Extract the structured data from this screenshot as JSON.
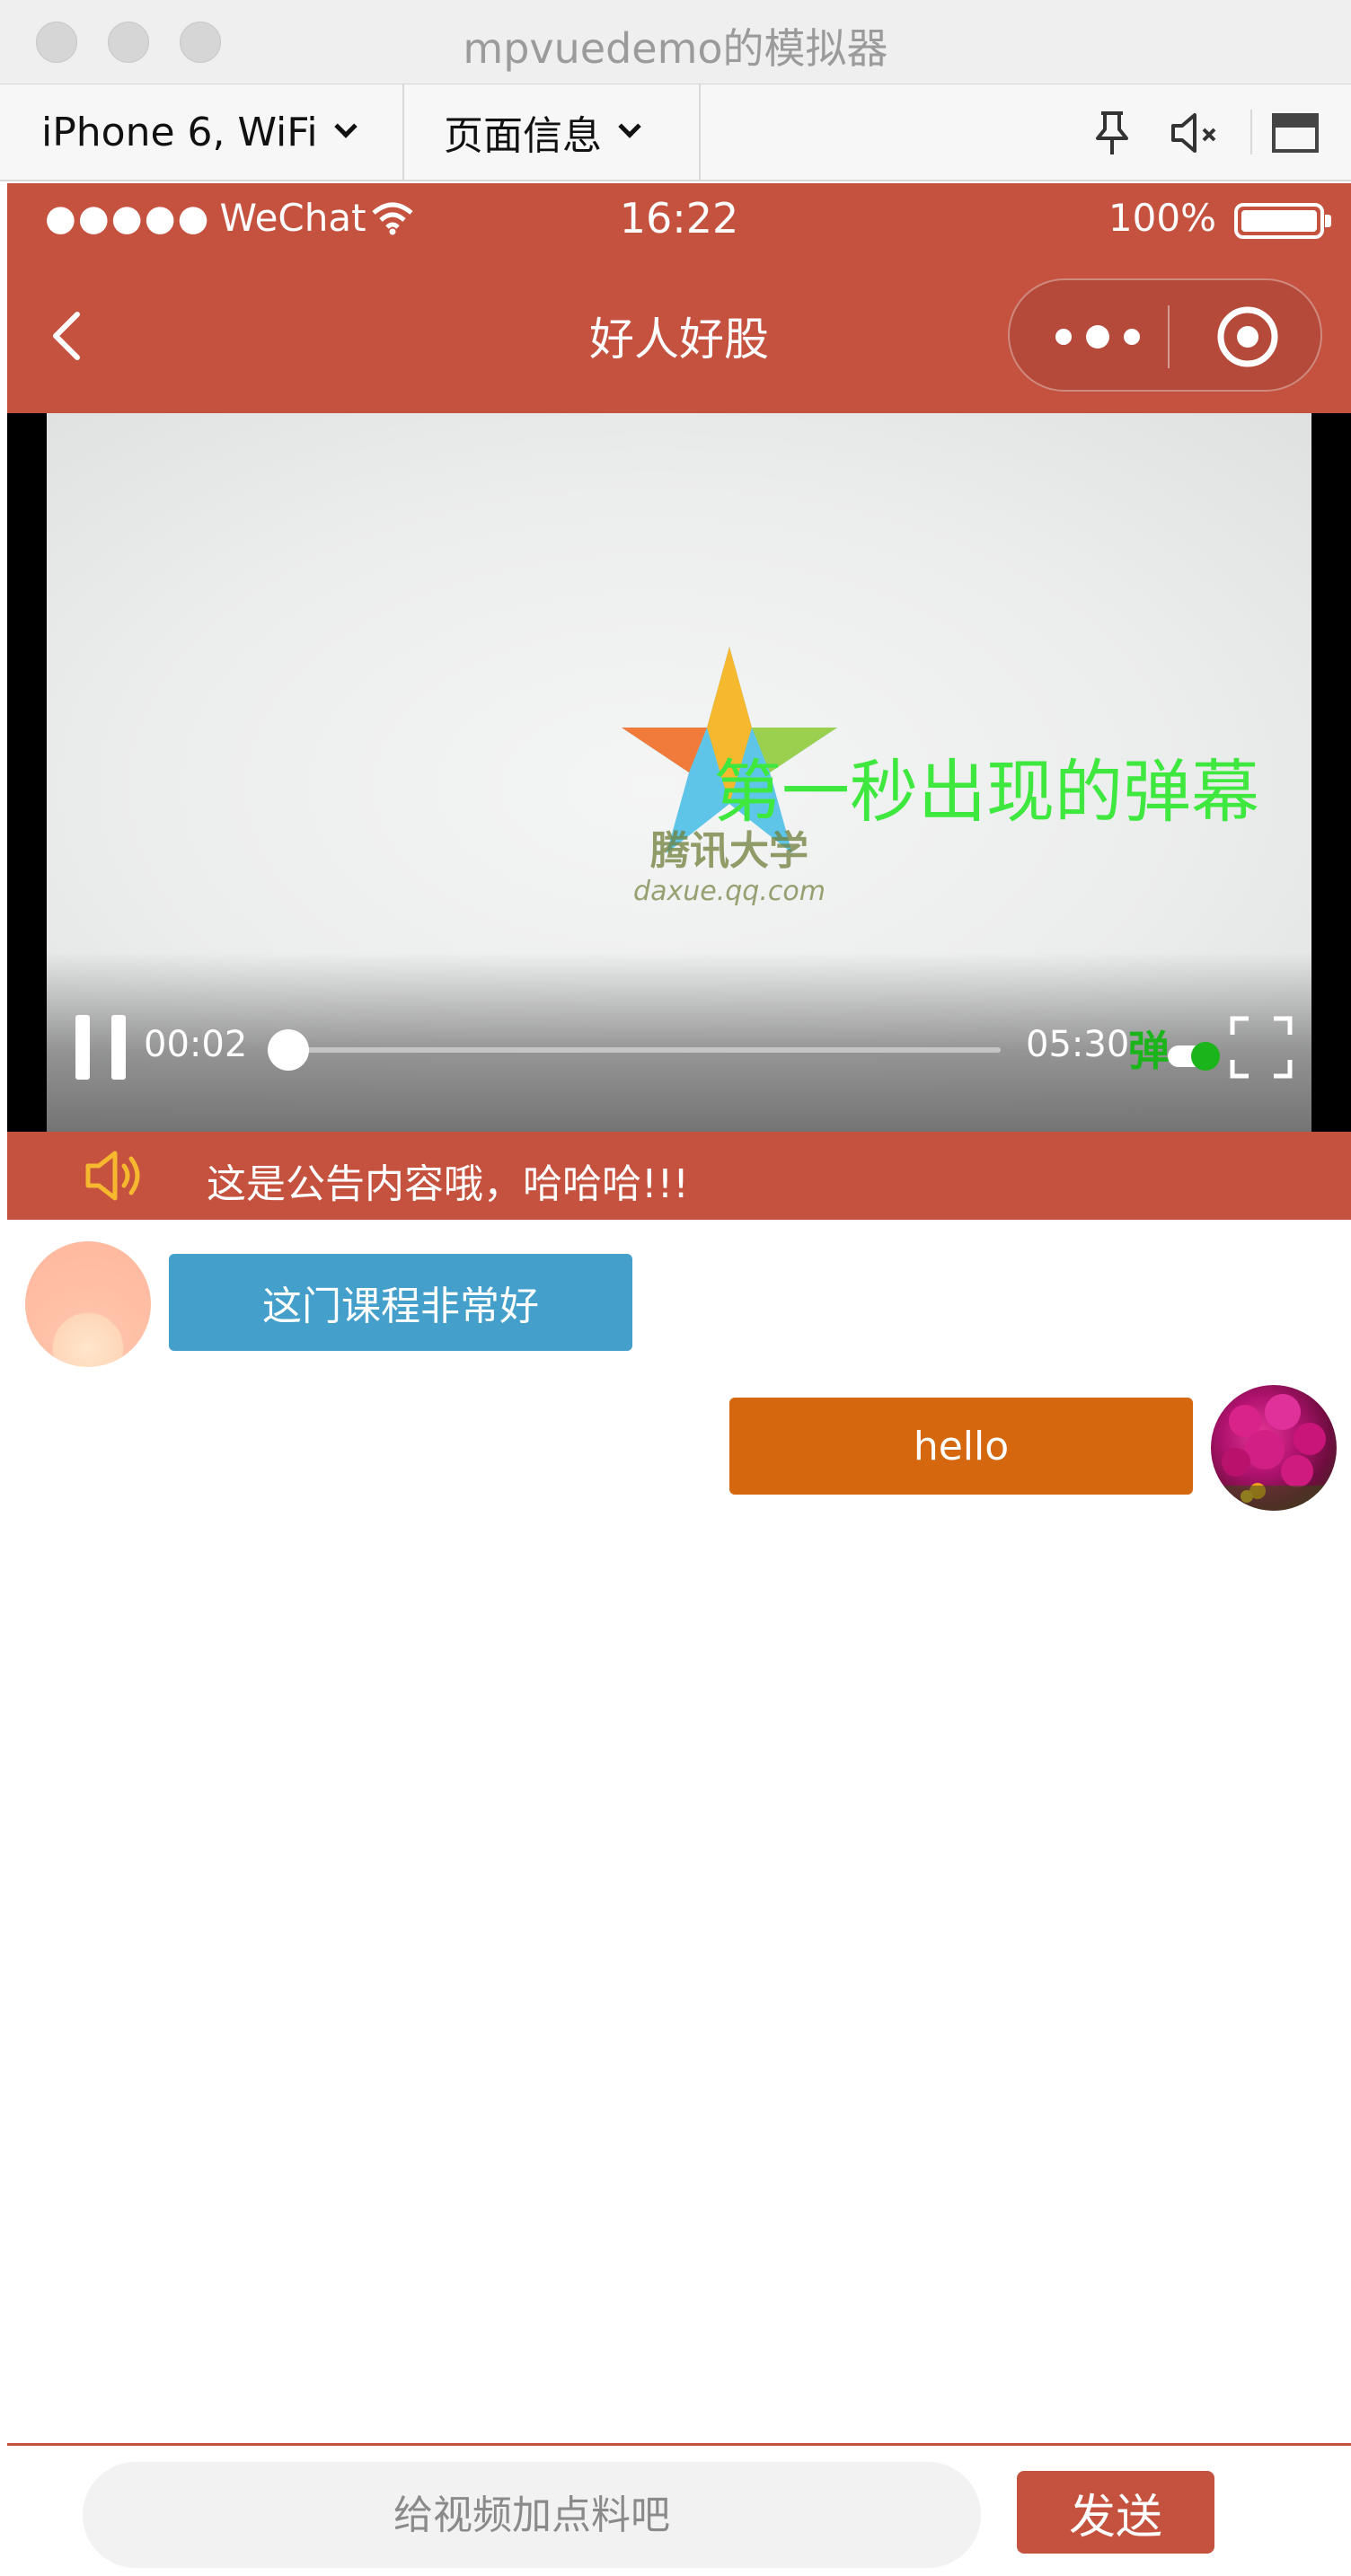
{
  "window": {
    "title": "mpvuedemo的模拟器"
  },
  "toolbar": {
    "device": "iPhone 6, WiFi",
    "page_info": "页面信息"
  },
  "status_bar": {
    "carrier_dots": "●●●●●",
    "carrier": "WeChat",
    "time": "16:22",
    "battery": "100%"
  },
  "nav": {
    "title": "好人好股"
  },
  "video": {
    "danmaku": "第一秒出现的弹幕",
    "current_time": "00:02",
    "duration": "05:30",
    "progress": 0.006,
    "danmaku_toggle": "弹",
    "logo_text": "腾讯大学",
    "logo_sub": "daxue.qq.com"
  },
  "notice": {
    "text": "这是公告内容哦，哈哈哈!!!"
  },
  "chat": {
    "messages": [
      {
        "side": "left",
        "text": "这门课程非常好"
      },
      {
        "side": "right",
        "text": "hello"
      }
    ]
  },
  "input": {
    "placeholder": "给视频加点料吧",
    "send_label": "发送"
  },
  "colors": {
    "theme": "#c5513f",
    "bubble_left": "#44a0cb",
    "bubble_right": "#d5670f",
    "danmaku": "#3ee83e"
  }
}
